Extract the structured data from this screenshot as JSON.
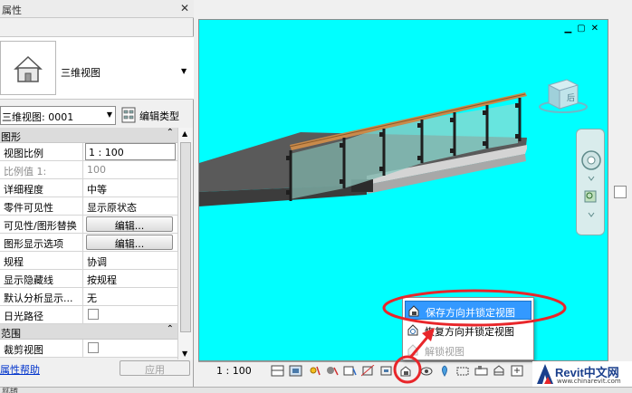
{
  "properties": {
    "title": "属性",
    "type_name": "三维视图",
    "instance_selector": "三维视图: 0001",
    "edit_type_label": "编辑类型",
    "groups": [
      {
        "name": "图形",
        "rows": [
          {
            "key": "视图比例",
            "value": "1 : 100"
          },
          {
            "key": "比例值 1:",
            "value": "100"
          },
          {
            "key": "详细程度",
            "value": "中等"
          },
          {
            "key": "零件可见性",
            "value": "显示原状态"
          },
          {
            "key": "可见性/图形替换",
            "value": "编辑..."
          },
          {
            "key": "图形显示选项",
            "value": "编辑..."
          },
          {
            "key": "规程",
            "value": "协调"
          },
          {
            "key": "显示隐藏线",
            "value": "按规程"
          },
          {
            "key": "默认分析显示...",
            "value": "无"
          },
          {
            "key": "日光路径",
            "value": ""
          }
        ]
      },
      {
        "name": "范围",
        "rows": [
          {
            "key": "裁剪视图",
            "value": ""
          }
        ]
      }
    ],
    "help_link": "属性帮助",
    "apply_label": "应用"
  },
  "viewport": {
    "background": "#00ffff",
    "viewcube_label": "后",
    "window_controls": [
      "minimize-icon",
      "restore-icon",
      "close-icon"
    ]
  },
  "view_control_bar": {
    "scale": "1 : 100"
  },
  "lock_menu": {
    "items": [
      {
        "label": "保存方向并锁定视图",
        "highlighted": true,
        "enabled": true
      },
      {
        "label": "恢复方向并锁定视图",
        "highlighted": false,
        "enabled": true
      },
      {
        "label": "解锁视图",
        "highlighted": false,
        "enabled": false
      }
    ]
  },
  "annotation": {
    "color": "#e8262a"
  },
  "logo": {
    "brand": "Revit中文网",
    "site": "www.chinarevit.com"
  },
  "status_bar": {
    "text": "就绪"
  }
}
